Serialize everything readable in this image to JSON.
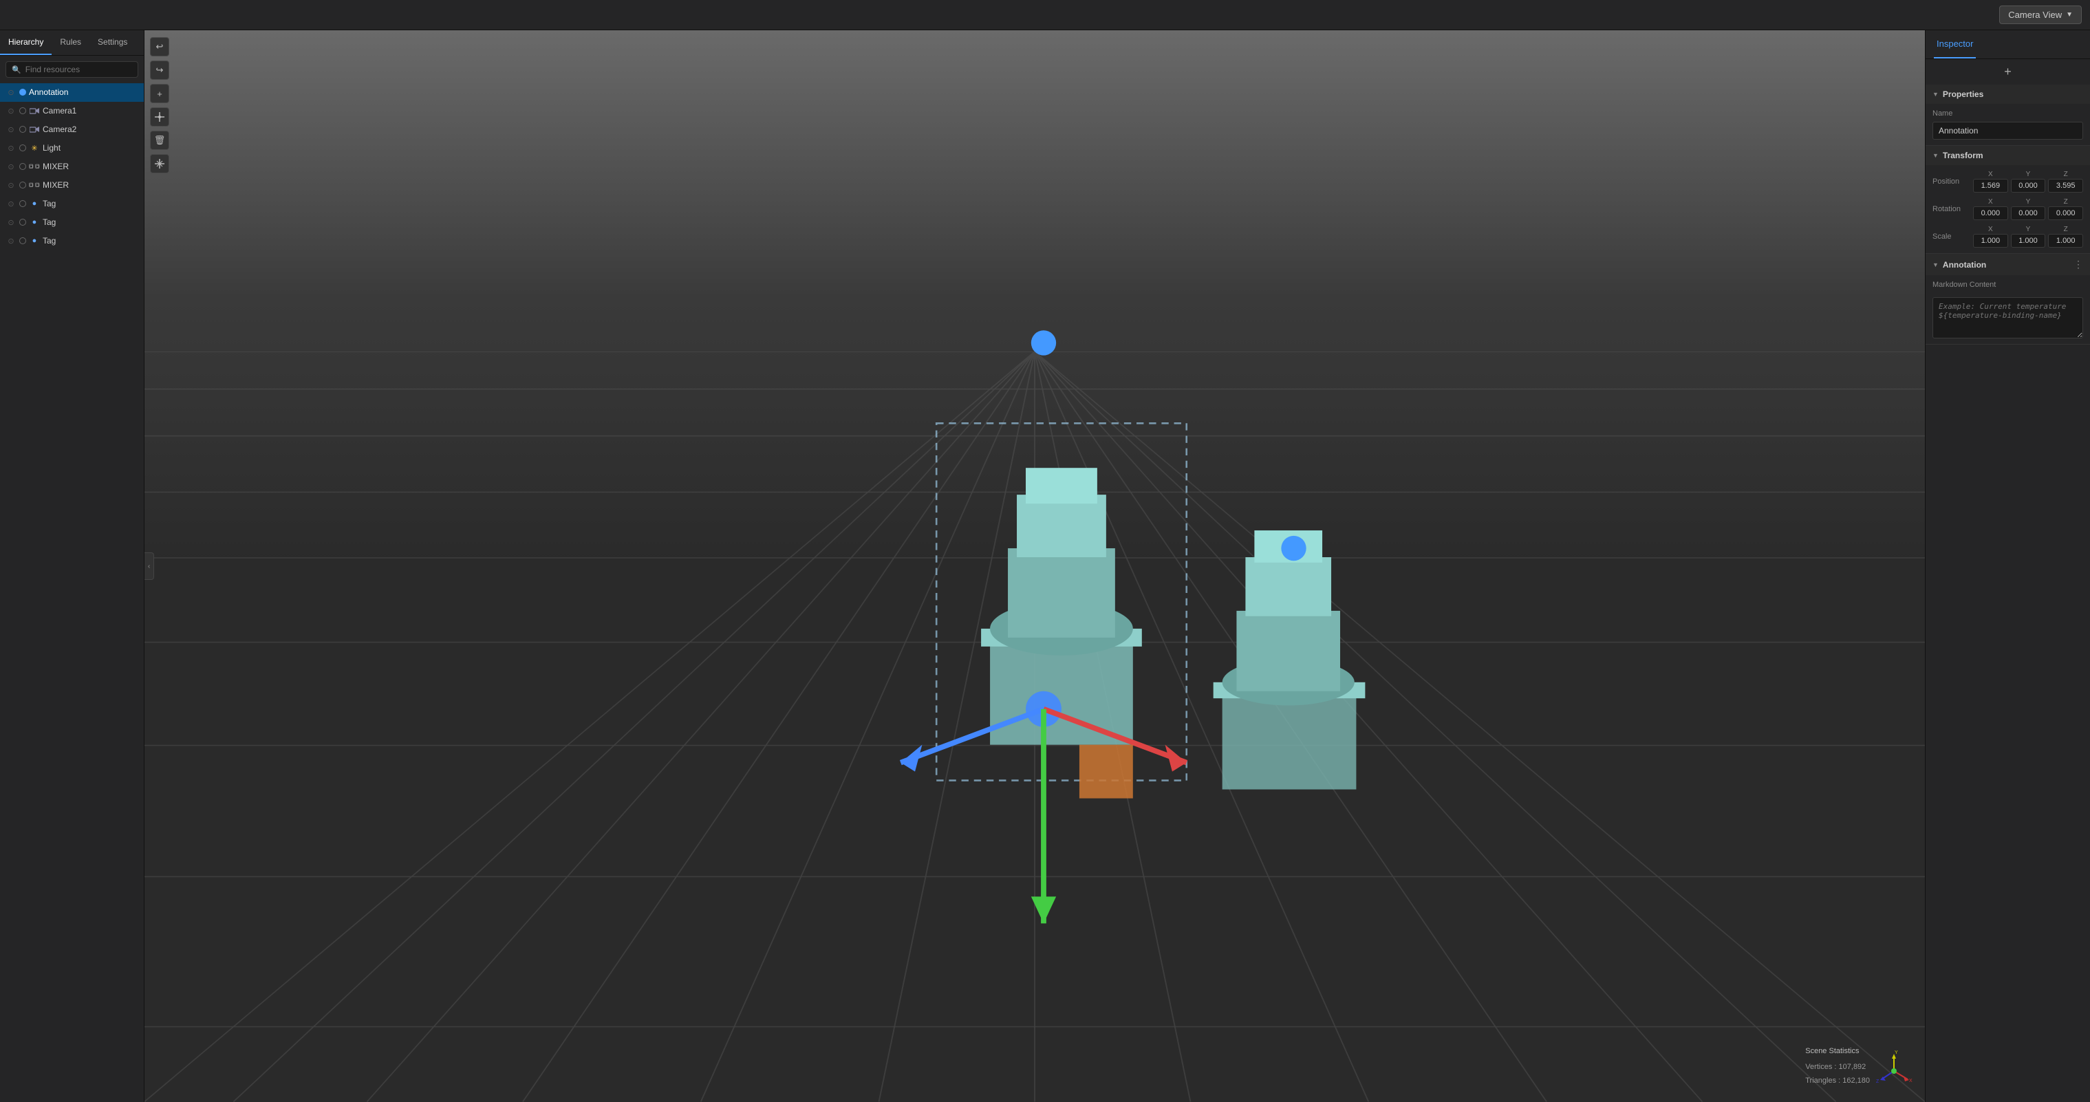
{
  "topBar": {
    "cameraViewLabel": "Camera View"
  },
  "sidebar": {
    "tabs": [
      {
        "id": "hierarchy",
        "label": "Hierarchy",
        "active": true
      },
      {
        "id": "rules",
        "label": "Rules",
        "active": false
      },
      {
        "id": "settings",
        "label": "Settings",
        "active": false
      }
    ],
    "search": {
      "placeholder": "Find resources"
    },
    "items": [
      {
        "id": "annotation",
        "label": "Annotation",
        "type": "annotation",
        "icon": "circle-blue",
        "selected": true
      },
      {
        "id": "camera1",
        "label": "Camera1",
        "type": "camera",
        "icon": "camera"
      },
      {
        "id": "camera2",
        "label": "Camera2",
        "type": "camera",
        "icon": "camera"
      },
      {
        "id": "light",
        "label": "Light",
        "type": "light",
        "icon": "light"
      },
      {
        "id": "mixer1",
        "label": "MIXER",
        "type": "mesh",
        "icon": "mesh"
      },
      {
        "id": "mixer2",
        "label": "MIXER",
        "type": "mesh",
        "icon": "mesh"
      },
      {
        "id": "tag1",
        "label": "Tag",
        "type": "tag",
        "icon": "tag"
      },
      {
        "id": "tag2",
        "label": "Tag",
        "type": "tag",
        "icon": "tag"
      },
      {
        "id": "tag3",
        "label": "Tag",
        "type": "tag",
        "icon": "tag"
      }
    ]
  },
  "viewport": {
    "sceneStats": {
      "label": "Scene Statistics",
      "vertices": "Vertices : 107,892",
      "triangles": "Triangles : 162,180"
    }
  },
  "inspector": {
    "tab": "Inspector",
    "addButtonLabel": "+",
    "sections": {
      "properties": {
        "label": "Properties",
        "name": {
          "label": "Name",
          "value": "Annotation"
        }
      },
      "transform": {
        "label": "Transform",
        "position": {
          "label": "Position",
          "x": "1.569",
          "y": "0.000",
          "z": "3.595"
        },
        "rotation": {
          "label": "Rotation",
          "x": "0.000",
          "y": "0.000",
          "z": "0.000"
        },
        "scale": {
          "label": "Scale",
          "x": "1.000",
          "y": "1.000",
          "z": "1.000"
        }
      },
      "annotation": {
        "label": "Annotation",
        "markdownLabel": "Markdown Content",
        "markdownPlaceholder": "Example: Current temperature ${temperature-binding-name}"
      }
    }
  },
  "toolbar": {
    "tools": [
      {
        "id": "undo",
        "icon": "↩",
        "label": "undo"
      },
      {
        "id": "redo",
        "icon": "↪",
        "label": "redo"
      },
      {
        "id": "add",
        "icon": "+",
        "label": "add"
      },
      {
        "id": "transform",
        "icon": "✛",
        "label": "transform"
      },
      {
        "id": "delete",
        "icon": "🗑",
        "label": "delete"
      },
      {
        "id": "move",
        "icon": "⊹",
        "label": "move"
      }
    ]
  }
}
